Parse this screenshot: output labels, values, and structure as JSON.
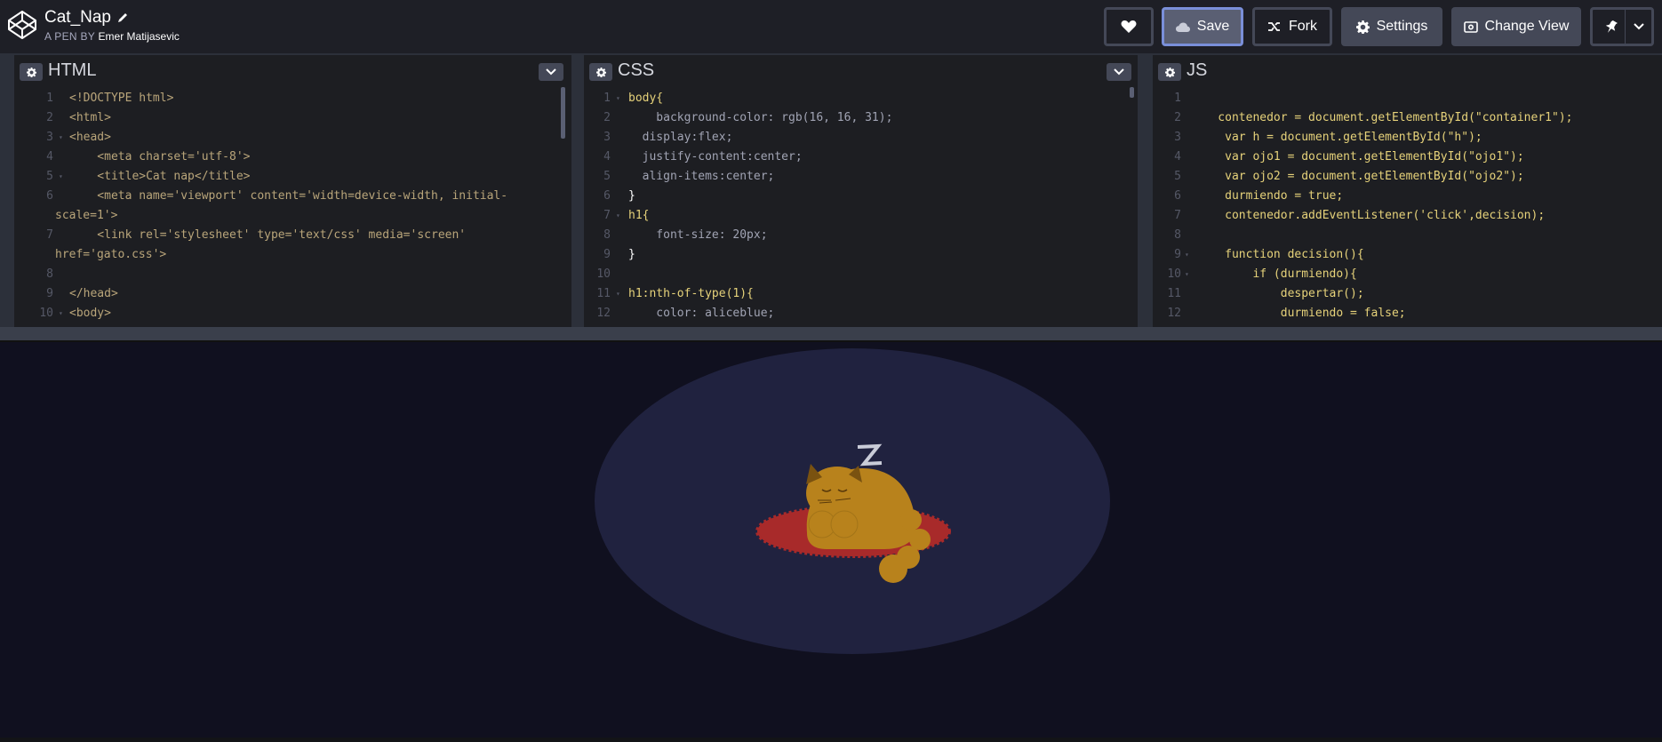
{
  "header": {
    "title": "Cat_Nap",
    "by_label": "A PEN BY",
    "author": "Emer Matijasevic",
    "buttons": {
      "save": "Save",
      "fork": "Fork",
      "settings": "Settings",
      "change_view": "Change View"
    }
  },
  "editors": {
    "html": {
      "name": "HTML",
      "lines": [
        {
          "n": "1",
          "text": "<!DOCTYPE html>"
        },
        {
          "n": "2",
          "text": "<html>"
        },
        {
          "n": "3",
          "text": "<head>"
        },
        {
          "n": "4",
          "text": "    <meta charset='utf-8'>"
        },
        {
          "n": "5",
          "text": "    <title>Cat nap</title>"
        },
        {
          "n": "6",
          "text": "    <meta name='viewport' content='width=device-width, initial-"
        },
        {
          "n": "",
          "text": "scale=1'>"
        },
        {
          "n": "7",
          "text": "    <link rel='stylesheet' type='text/css' media='screen'"
        },
        {
          "n": "",
          "text": "href='gato.css'>"
        },
        {
          "n": "8",
          "text": ""
        },
        {
          "n": "9",
          "text": "</head>"
        },
        {
          "n": "10",
          "text": "<body>"
        }
      ]
    },
    "css": {
      "name": "CSS",
      "lines": [
        {
          "n": "1",
          "text": "body{"
        },
        {
          "n": "2",
          "text": "    background-color: rgb(16, 16, 31);"
        },
        {
          "n": "3",
          "text": "  display:flex;"
        },
        {
          "n": "4",
          "text": "  justify-content:center;"
        },
        {
          "n": "5",
          "text": "  align-items:center;"
        },
        {
          "n": "6",
          "text": "}"
        },
        {
          "n": "7",
          "text": "h1{"
        },
        {
          "n": "8",
          "text": "    font-size: 20px;"
        },
        {
          "n": "9",
          "text": "}"
        },
        {
          "n": "10",
          "text": ""
        },
        {
          "n": "11",
          "text": "h1:nth-of-type(1){"
        },
        {
          "n": "12",
          "text": "    color: aliceblue;"
        }
      ]
    },
    "js": {
      "name": "JS",
      "lines": [
        {
          "n": "1",
          "text": ""
        },
        {
          "n": "2",
          "text": "    contenedor = document.getElementById(\"container1\");"
        },
        {
          "n": "3",
          "text": "     var h = document.getElementById(\"h\");"
        },
        {
          "n": "4",
          "text": "     var ojo1 = document.getElementById(\"ojo1\");"
        },
        {
          "n": "5",
          "text": "     var ojo2 = document.getElementById(\"ojo2\");"
        },
        {
          "n": "6",
          "text": "     durmiendo = true;"
        },
        {
          "n": "7",
          "text": "     contenedor.addEventListener('click',decision);"
        },
        {
          "n": "8",
          "text": ""
        },
        {
          "n": "9",
          "text": "     function decision(){"
        },
        {
          "n": "10",
          "text": "         if (durmiendo){"
        },
        {
          "n": "11",
          "text": "             despertar();"
        },
        {
          "n": "12",
          "text": "             durmiendo = false;"
        }
      ]
    }
  },
  "colors": {
    "header_bg": "#1e1f26",
    "editor_bg": "#1d1e22",
    "preview_bg": "#10101f",
    "spotlight": "#20223f",
    "cat": "#b8821c",
    "rug": "#a82a2a"
  },
  "icons": [
    "codepen-logo-icon",
    "pencil-icon",
    "heart-icon",
    "cloud-icon",
    "fork-icon",
    "gear-icon",
    "change-view-icon",
    "pin-icon",
    "chevron-down-icon"
  ]
}
